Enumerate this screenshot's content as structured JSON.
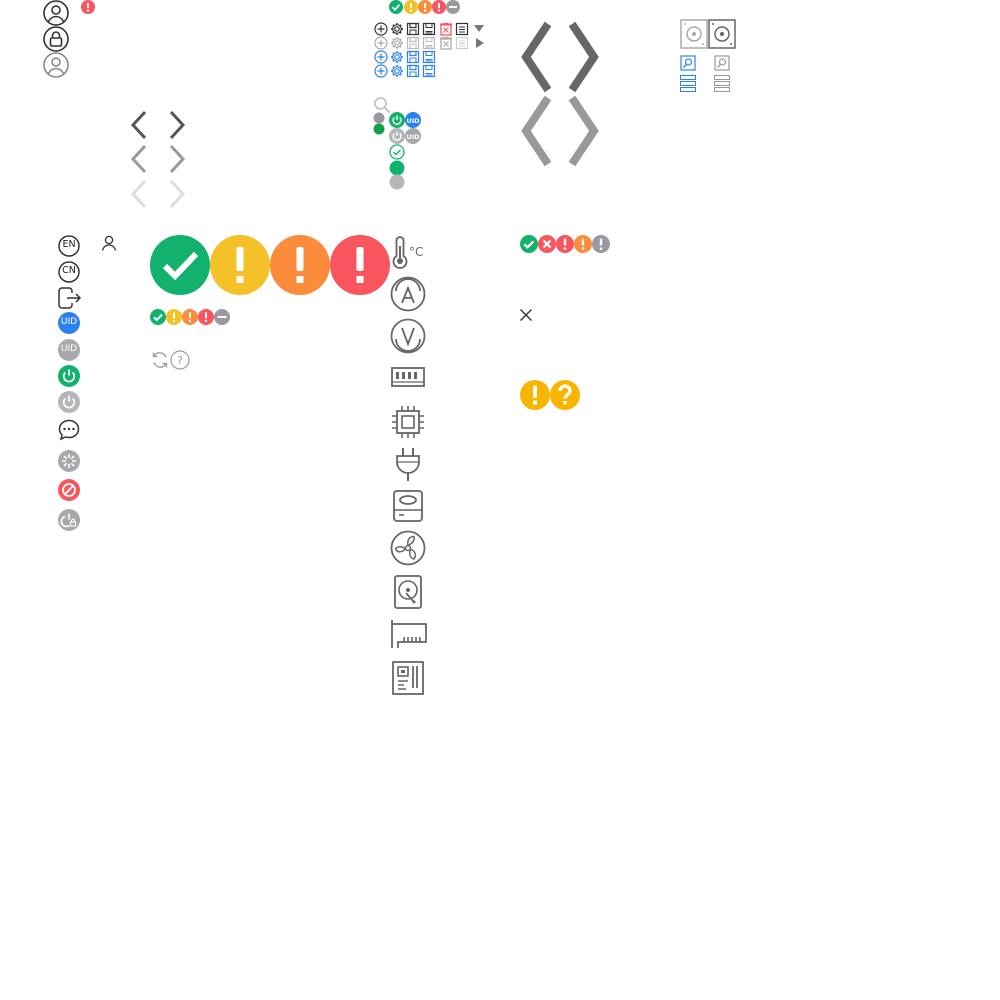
{
  "colors": {
    "ok": "#12b26e",
    "minor": "#f5c12a",
    "major": "#fb8c3c",
    "critical": "#f9555f",
    "unknown": "#999aa0",
    "info": "#2b82ef",
    "dark_icon": "#333333",
    "gray_icon": "#666666",
    "light_icon": "#cccccc",
    "warn_yellow": "#f7b500"
  },
  "badges": {
    "uid_label": "UID",
    "en_label": "EN",
    "cn_label": "CN"
  },
  "units": {
    "temperature": "°C"
  },
  "icons": [
    "user-circle-icon",
    "lock-circle-icon",
    "user-circle-gray-icon",
    "alert-badge-icon",
    "chevron-left-icon",
    "chevron-right-icon",
    "chevron-up-large-icon",
    "chevron-down-large-icon",
    "add-circle-icon",
    "gear-icon",
    "floppy-disk-icon",
    "save-as-icon",
    "delete-icon",
    "list-icon",
    "triangle-down-icon",
    "triangle-right-icon",
    "search-icon",
    "power-icon",
    "uid-icon",
    "check-circle-icon",
    "status-dot-icon",
    "disk-icon",
    "server-icon",
    "language-en-icon",
    "language-cn-icon",
    "logout-icon",
    "user-icon",
    "chat-icon",
    "loading-icon",
    "forbidden-icon",
    "power-lock-icon",
    "refresh-icon",
    "help-icon",
    "thermometer-icon",
    "ampere-icon",
    "voltage-icon",
    "memory-icon",
    "cpu-icon",
    "plug-icon",
    "storage-icon",
    "fan-icon",
    "hard-disk-icon",
    "pcie-card-icon",
    "mainboard-icon",
    "close-icon",
    "warning-icon",
    "question-icon"
  ]
}
